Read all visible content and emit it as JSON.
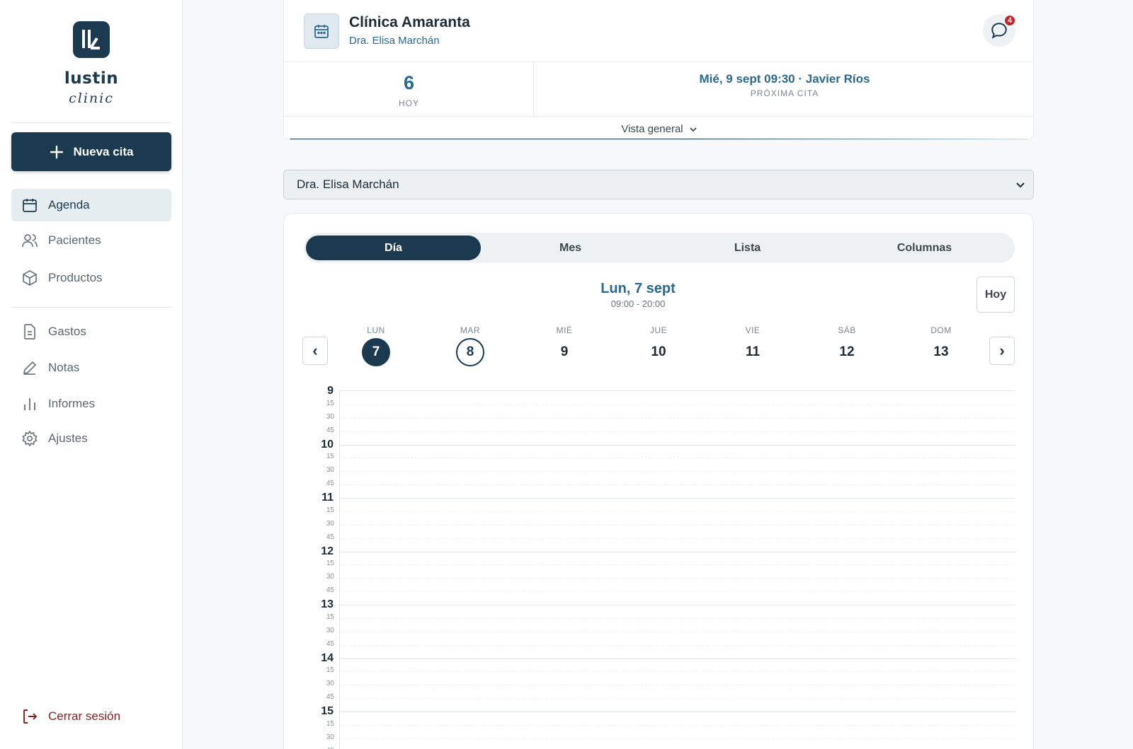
{
  "brand": {
    "word": "lustin",
    "sub": "clinic"
  },
  "sidebar": {
    "new_button": "Nueva cita",
    "items": [
      {
        "label": "Agenda",
        "icon": "calendar-icon",
        "active": true
      },
      {
        "label": "Pacientes",
        "icon": "users-icon"
      },
      {
        "label": "Productos",
        "icon": "box-icon"
      },
      {
        "label": "Gastos",
        "icon": "document-icon"
      },
      {
        "label": "Notas",
        "icon": "pen-icon"
      },
      {
        "label": "Informes",
        "icon": "bar-chart-icon"
      },
      {
        "label": "Ajustes",
        "icon": "gear-icon"
      }
    ],
    "logout": "Cerrar sesión"
  },
  "header": {
    "clinic_name": "Clínica Amaranta",
    "doctor": "Dra. Elisa Marchán",
    "chat_badge": "4",
    "today_count": "6",
    "today_label": "HOY",
    "next_appointment": "Mié, 9 sept 09:30 · Javier Ríos",
    "next_label": "PRÓXIMA CITA",
    "overview": "Vista general"
  },
  "doctor_select": {
    "value": "Dra. Elisa Marchán"
  },
  "calendar": {
    "tabs": [
      "Día",
      "Mes",
      "Lista",
      "Columnas"
    ],
    "active_tab": "Día",
    "date_title": "Lun, 7 sept",
    "date_range": "09:00 - 20:00",
    "today_button": "Hoy",
    "prev": "‹",
    "next": "›",
    "days": [
      {
        "name": "LUN",
        "num": "7",
        "state": "selected"
      },
      {
        "name": "MAR",
        "num": "8",
        "state": "today"
      },
      {
        "name": "MIÉ",
        "num": "9"
      },
      {
        "name": "JUE",
        "num": "10"
      },
      {
        "name": "VIE",
        "num": "11"
      },
      {
        "name": "SÁB",
        "num": "12"
      },
      {
        "name": "DOM",
        "num": "13"
      }
    ],
    "hours": [
      "9",
      "10",
      "11",
      "12",
      "13",
      "14",
      "15"
    ],
    "minute_marks": [
      "15",
      "30",
      "45"
    ]
  },
  "colors": {
    "primary": "#1b3a4f",
    "accent": "#2a6a8e",
    "danger": "#8a1f1f",
    "badge": "#c0262a"
  }
}
